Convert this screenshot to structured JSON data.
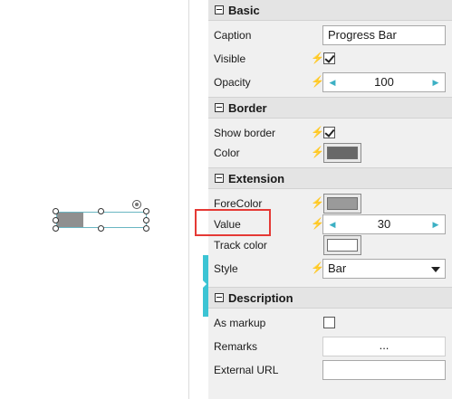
{
  "canvas": {
    "widget_value": 30,
    "widget_fill_color": "#8f8f8f",
    "accent_color": "#3cc4d4"
  },
  "panel": {
    "basic": {
      "title": "Basic",
      "caption_label": "Caption",
      "caption_value": "Progress Bar",
      "visible_label": "Visible",
      "visible_checked": true,
      "opacity_label": "Opacity",
      "opacity_value": "100"
    },
    "border": {
      "title": "Border",
      "show_border_label": "Show border",
      "show_border_checked": true,
      "color_label": "Color",
      "color_value": "#686868"
    },
    "extension": {
      "title": "Extension",
      "forecolor_label": "ForeColor",
      "forecolor_value": "#9a9a9a",
      "value_label": "Value",
      "value_value": "30",
      "track_color_label": "Track color",
      "track_color_value": "#ffffff",
      "style_label": "Style",
      "style_value": "Bar"
    },
    "description": {
      "title": "Description",
      "as_markup_label": "As markup",
      "as_markup_checked": false,
      "remarks_label": "Remarks",
      "remarks_button": "...",
      "external_url_label": "External URL",
      "external_url_value": ""
    }
  },
  "icons": {
    "collapse": "minus-box-icon",
    "binding": "lightning-icon",
    "spin_decrement": "triangle-left-icon",
    "spin_increment": "triangle-right-icon",
    "dropdown": "caret-down-icon"
  },
  "highlight_color": "#e53935"
}
